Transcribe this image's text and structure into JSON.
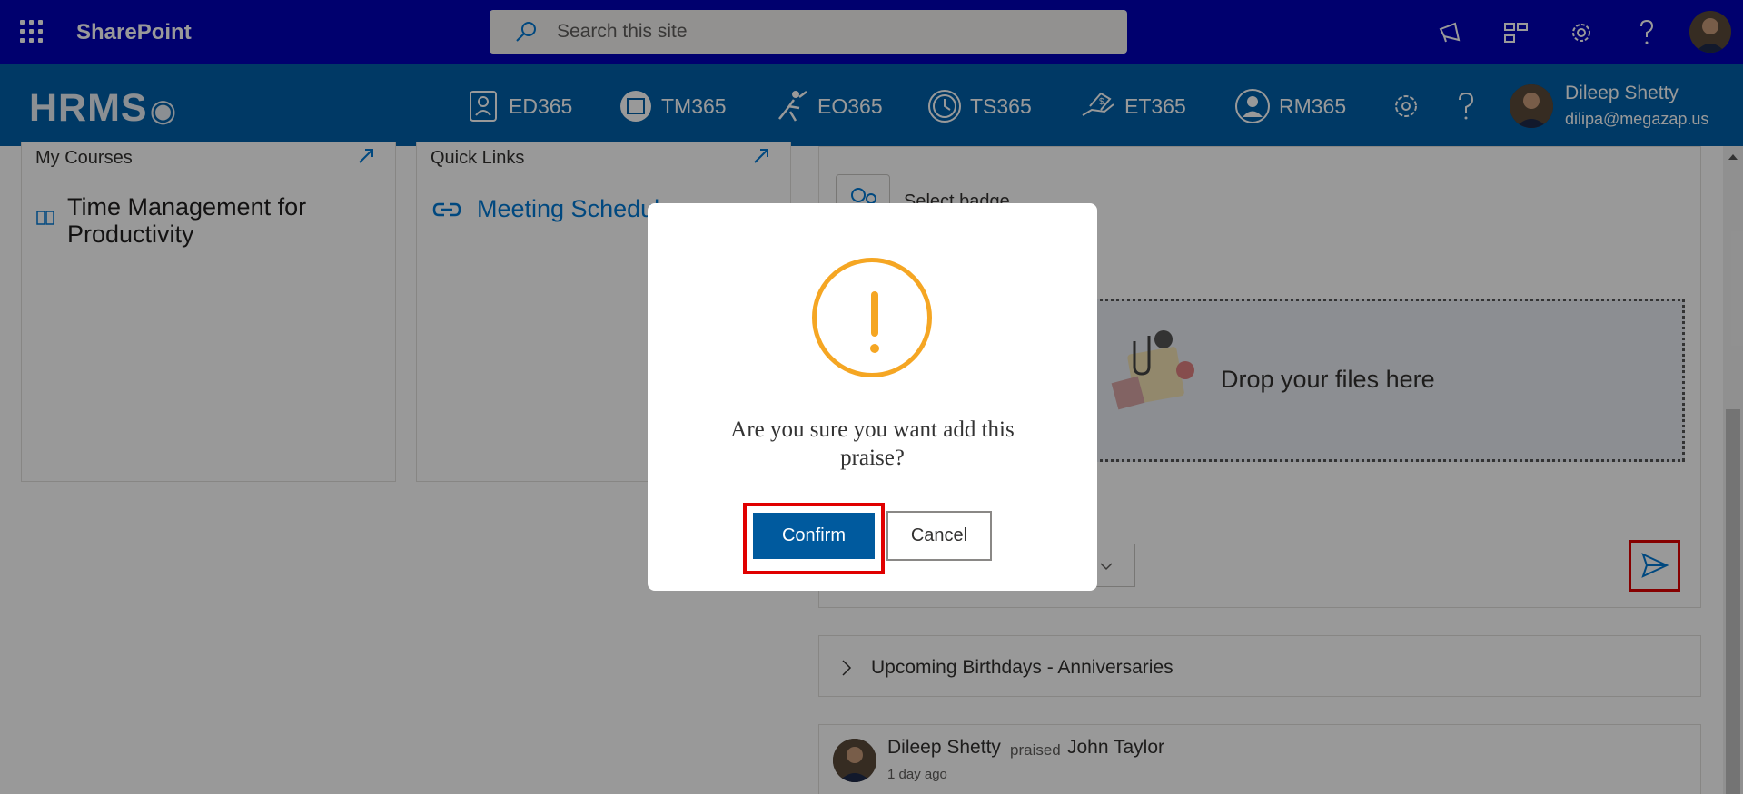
{
  "suite_bar": {
    "app_name": "SharePoint",
    "search_placeholder": "Search this site",
    "icons": [
      "app-launcher-icon",
      "megaphone-icon",
      "share-network-icon",
      "settings-icon",
      "help-icon",
      "avatar"
    ]
  },
  "hrms_nav": {
    "logo": "HRMS",
    "items": [
      {
        "label": "ED365",
        "icon": "employee-directory-icon"
      },
      {
        "label": "TM365",
        "icon": "calendar-icon"
      },
      {
        "label": "EO365",
        "icon": "onboarding-runner-icon"
      },
      {
        "label": "TS365",
        "icon": "clock-icon"
      },
      {
        "label": "ET365",
        "icon": "expense-hand-icon"
      },
      {
        "label": "RM365",
        "icon": "user-circle-icon"
      }
    ],
    "user": {
      "name": "Dileep Shetty",
      "email": "dilipa@megazap.us"
    }
  },
  "page": {
    "my_courses": {
      "title": "My Courses",
      "course": "Time Management for Productivity"
    },
    "quick_links": {
      "title": "Quick Links",
      "link": "Meeting Schedul"
    },
    "praise_panel": {
      "select_badge": "Select badge",
      "drop_text": "Drop your files here"
    },
    "birthdays": {
      "title": "Upcoming Birthdays - Anniversaries"
    },
    "feed": {
      "actor": "Dileep Shetty",
      "verb": "praised",
      "target": "John Taylor",
      "time": "1 day ago"
    }
  },
  "modal": {
    "message": "Are you sure you want add this praise?",
    "confirm_label": "Confirm",
    "cancel_label": "Cancel"
  },
  "colors": {
    "suite_bar": "#0000b8",
    "hrms_bar": "#0060a8",
    "warning": "#f5a623",
    "confirm": "#005a9e",
    "highlight": "#e00000"
  }
}
